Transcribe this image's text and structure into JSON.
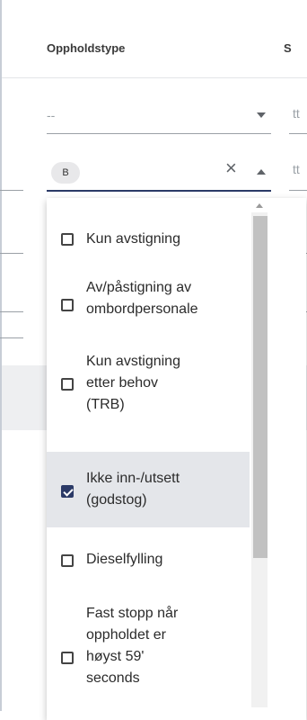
{
  "header": {
    "column_title": "Oppholdstype",
    "next_column_title_partial": "S"
  },
  "rows": [
    {
      "value": "--",
      "tt": "tt"
    },
    {
      "chip": "B",
      "tt": "tt"
    },
    {
      "tt": "tt"
    },
    {
      "tt": "tt"
    }
  ],
  "dropdown": {
    "options": [
      {
        "label": "Kun avstigning",
        "checked": false
      },
      {
        "label": "Av/påstigning av\nombordpersonale",
        "checked": false
      },
      {
        "label": "Kun avstigning\netter behov\n(TRB)",
        "checked": false
      },
      {
        "label": "Ikke inn-/utsett\n(godstog)",
        "checked": true
      },
      {
        "label": "Dieselfylling",
        "checked": false
      },
      {
        "label": "Fast stopp når\noppholdet er\nhøyst 59'\nseconds",
        "checked": false
      }
    ]
  },
  "icons": {
    "clear": "close-icon",
    "dropdown_closed": "caret-down-icon",
    "dropdown_open": "caret-up-icon"
  }
}
